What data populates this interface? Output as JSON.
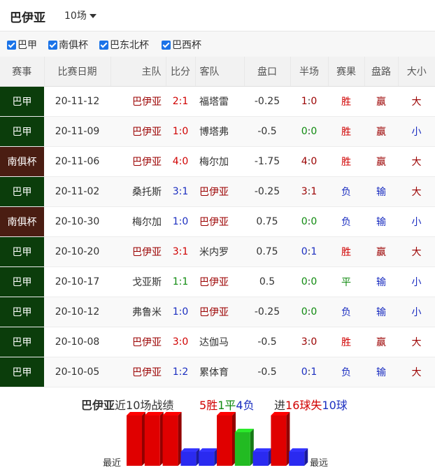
{
  "header": {
    "team": "巴伊亚",
    "count": "10场"
  },
  "filters": [
    "巴甲",
    "南俱杯",
    "巴东北杯",
    "巴西杯"
  ],
  "columns": [
    "赛事",
    "比赛日期",
    "主队",
    "比分",
    "客队",
    "盘口",
    "半场",
    "赛果",
    "盘路",
    "大小"
  ],
  "rows": [
    {
      "comp": "巴甲",
      "type": "league",
      "date": "20-11-12",
      "home": "巴伊亚",
      "hs": "2",
      "as": "1",
      "away": "福塔雷",
      "line": "-0.25",
      "hhs": "1",
      "has": "0",
      "res": "胜",
      "pan": "赢",
      "ou": "大"
    },
    {
      "comp": "巴甲",
      "type": "league",
      "date": "20-11-09",
      "home": "巴伊亚",
      "hs": "1",
      "as": "0",
      "away": "博塔弗",
      "line": "-0.5",
      "hhs": "0",
      "has": "0",
      "res": "胜",
      "pan": "赢",
      "ou": "小"
    },
    {
      "comp": "南俱杯",
      "type": "cup",
      "date": "20-11-06",
      "home": "巴伊亚",
      "hs": "4",
      "as": "0",
      "away": "梅尔加",
      "line": "-1.75",
      "hhs": "4",
      "has": "0",
      "res": "胜",
      "pan": "赢",
      "ou": "大"
    },
    {
      "comp": "巴甲",
      "type": "league",
      "date": "20-11-02",
      "home": "桑托斯",
      "hs": "3",
      "as": "1",
      "away": "巴伊亚",
      "line": "-0.25",
      "hhs": "3",
      "has": "1",
      "res": "负",
      "pan": "输",
      "ou": "大"
    },
    {
      "comp": "南俱杯",
      "type": "cup",
      "date": "20-10-30",
      "home": "梅尔加",
      "hs": "1",
      "as": "0",
      "away": "巴伊亚",
      "line": "0.75",
      "hhs": "0",
      "has": "0",
      "res": "负",
      "pan": "输",
      "ou": "小"
    },
    {
      "comp": "巴甲",
      "type": "league",
      "date": "20-10-20",
      "home": "巴伊亚",
      "hs": "3",
      "as": "1",
      "away": "米内罗",
      "line": "0.75",
      "hhs": "0",
      "has": "1",
      "res": "胜",
      "pan": "赢",
      "ou": "大"
    },
    {
      "comp": "巴甲",
      "type": "league",
      "date": "20-10-17",
      "home": "戈亚斯",
      "hs": "1",
      "as": "1",
      "away": "巴伊亚",
      "line": "0.5",
      "hhs": "0",
      "has": "0",
      "res": "平",
      "pan": "输",
      "ou": "小"
    },
    {
      "comp": "巴甲",
      "type": "league",
      "date": "20-10-12",
      "home": "弗鲁米",
      "hs": "1",
      "as": "0",
      "away": "巴伊亚",
      "line": "-0.25",
      "hhs": "0",
      "has": "0",
      "res": "负",
      "pan": "输",
      "ou": "小"
    },
    {
      "comp": "巴甲",
      "type": "league",
      "date": "20-10-08",
      "home": "巴伊亚",
      "hs": "3",
      "as": "0",
      "away": "达伽马",
      "line": "-0.5",
      "hhs": "3",
      "has": "0",
      "res": "胜",
      "pan": "赢",
      "ou": "大"
    },
    {
      "comp": "巴甲",
      "type": "league",
      "date": "20-10-05",
      "home": "巴伊亚",
      "hs": "1",
      "as": "2",
      "away": "累体育",
      "line": "-0.5",
      "hhs": "0",
      "has": "1",
      "res": "负",
      "pan": "输",
      "ou": "大"
    }
  ],
  "summary": {
    "team": "巴伊亚",
    "label": "近10场战绩",
    "w": "5",
    "w_unit": "胜",
    "d": "1",
    "d_unit": "平",
    "l": "4",
    "l_unit": "负",
    "gf_pre": "进",
    "gf": "16",
    "gf_unit": "球失",
    "ga": "10",
    "ga_unit": "球",
    "recent_label": "最近",
    "far_label": "最远"
  },
  "form_chart": {
    "results": [
      "胜",
      "胜",
      "胜",
      "负",
      "负",
      "胜",
      "平",
      "负",
      "胜",
      "负"
    ],
    "colors": {
      "胜": "#e00000",
      "平": "#22bb22",
      "负": "#2a2af0"
    }
  }
}
